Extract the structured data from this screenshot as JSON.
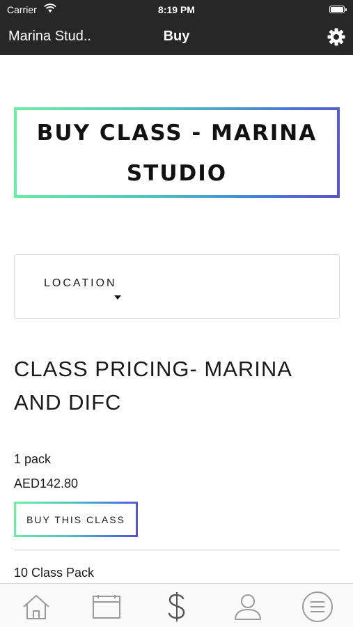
{
  "status_bar": {
    "carrier": "Carrier",
    "time": "8:19 PM"
  },
  "nav": {
    "back_title": "Marina Stud..",
    "title": "Buy"
  },
  "hero": {
    "line1": "BUY CLASS - MARINA",
    "line2": "STUDIO"
  },
  "location": {
    "label": "LOCATION"
  },
  "pricing": {
    "title_line1": "CLASS PRICING- MARINA",
    "title_line2": "AND DIFC",
    "items": [
      {
        "name": "1 pack",
        "price": "AED142.80",
        "button": "BUY THIS CLASS"
      },
      {
        "name": "10 Class Pack"
      }
    ]
  },
  "tabs": [
    {
      "icon": "home-icon"
    },
    {
      "icon": "calendar-icon"
    },
    {
      "icon": "dollar-icon",
      "active": true
    },
    {
      "icon": "user-icon"
    },
    {
      "icon": "menu-icon"
    }
  ],
  "colors": {
    "bar_bg": "#272727",
    "gradient_start": "#6df0a0",
    "gradient_end": "#5b54c8",
    "tab_icon": "#9a9a9a",
    "tab_icon_active": "#555555"
  }
}
